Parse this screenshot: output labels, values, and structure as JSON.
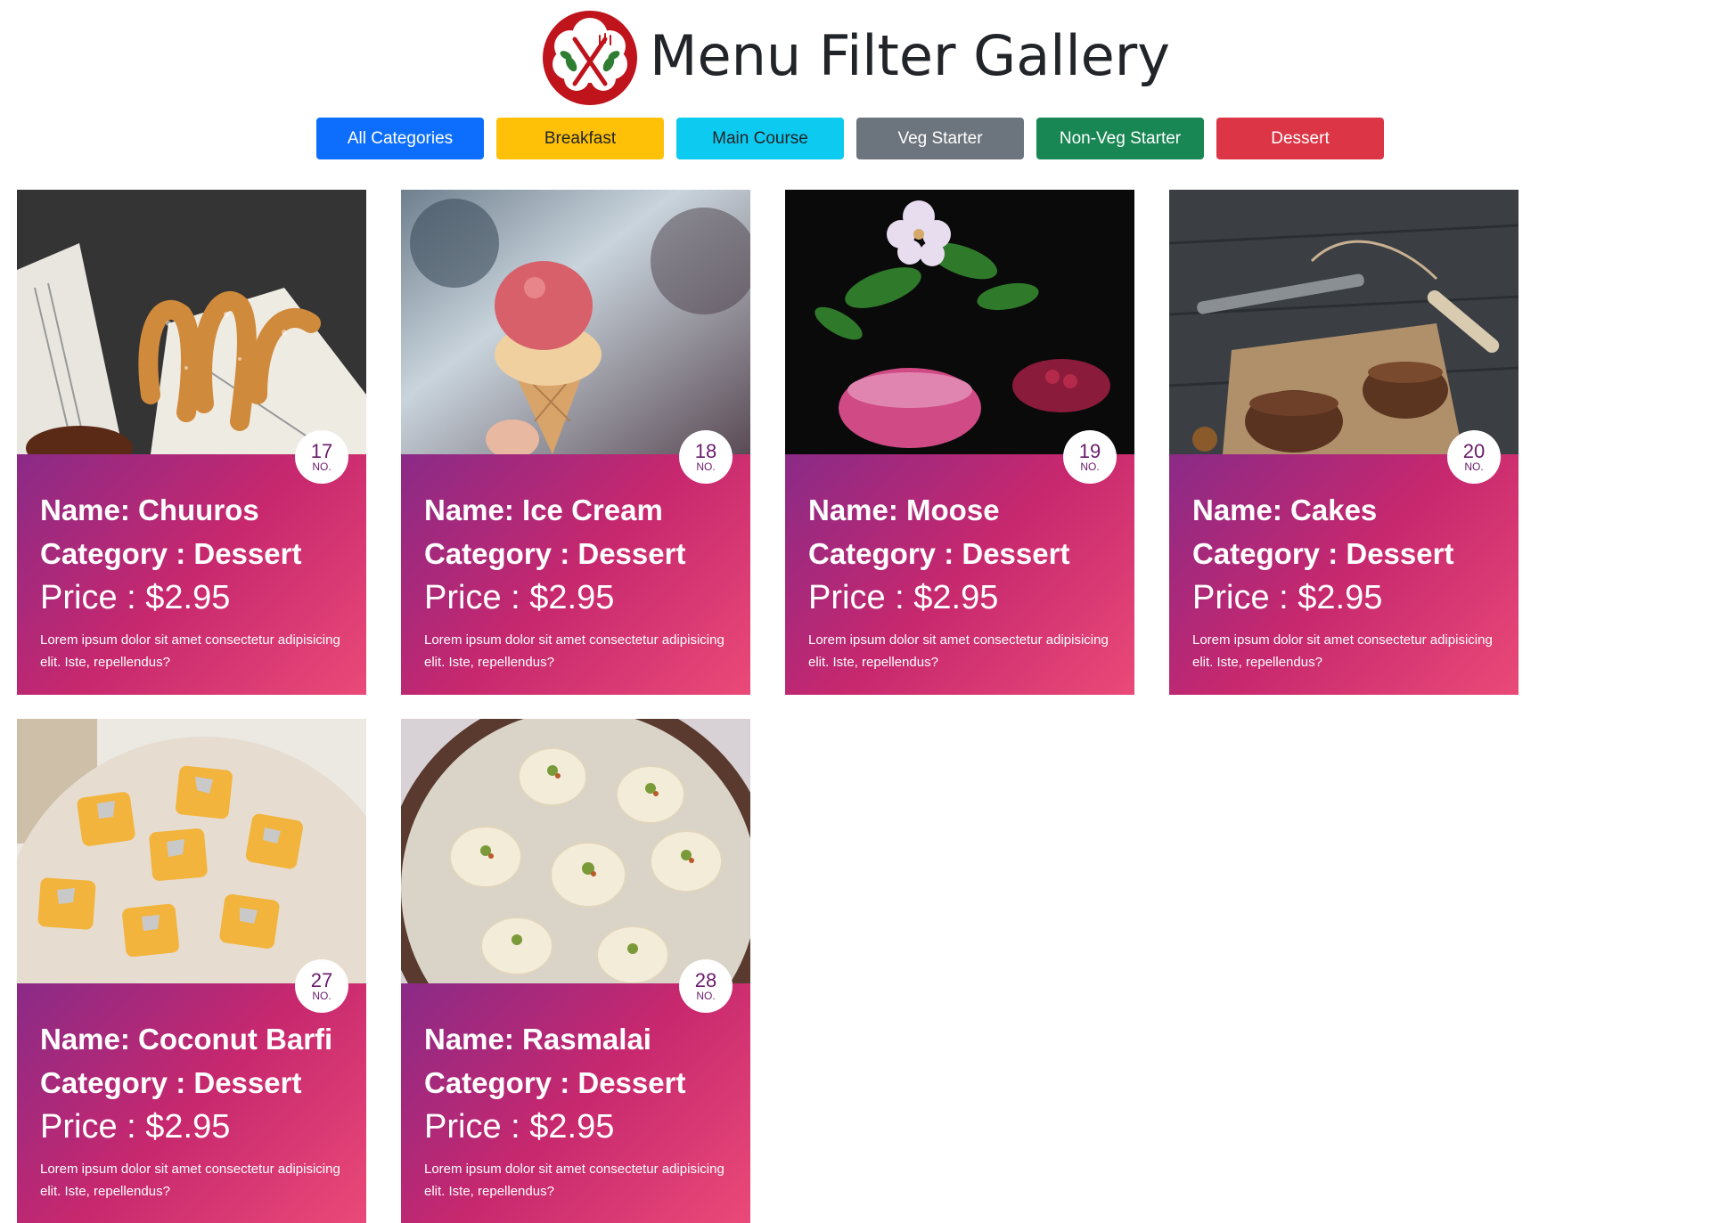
{
  "header": {
    "title": "Menu Filter Gallery",
    "logo_icon": "restaurant-logo-fork-knife-icon"
  },
  "filters": [
    {
      "label": "All Categories",
      "color": "#0d6efd"
    },
    {
      "label": "Breakfast",
      "color": "#ffc107"
    },
    {
      "label": "Main Course",
      "color": "#0dcaf0"
    },
    {
      "label": "Veg Starter",
      "color": "#6c757d"
    },
    {
      "label": "Non-Veg Starter",
      "color": "#198754"
    },
    {
      "label": "Dessert",
      "color": "#dc3545"
    }
  ],
  "cards": [
    {
      "number": "17",
      "no_label": "NO.",
      "name": "Name: Chuuros",
      "category": "Category : Dessert",
      "price": "Price : $2.95",
      "description": "Lorem ipsum dolor sit amet consectetur adipisicing elit. Iste, repellendus?"
    },
    {
      "number": "18",
      "no_label": "NO.",
      "name": "Name: Ice Cream",
      "category": "Category : Dessert",
      "price": "Price : $2.95",
      "description": "Lorem ipsum dolor sit amet consectetur adipisicing elit. Iste, repellendus?"
    },
    {
      "number": "19",
      "no_label": "NO.",
      "name": "Name: Moose",
      "category": "Category : Dessert",
      "price": "Price : $2.95",
      "description": "Lorem ipsum dolor sit amet consectetur adipisicing elit. Iste, repellendus?"
    },
    {
      "number": "20",
      "no_label": "NO.",
      "name": "Name: Cakes",
      "category": "Category : Dessert",
      "price": "Price : $2.95",
      "description": "Lorem ipsum dolor sit amet consectetur adipisicing elit. Iste, repellendus?"
    },
    {
      "number": "27",
      "no_label": "NO.",
      "name": "Name: Coconut Barfi",
      "category": "Category : Dessert",
      "price": "Price : $2.95",
      "description": "Lorem ipsum dolor sit amet consectetur adipisicing elit. Iste, repellendus?"
    },
    {
      "number": "28",
      "no_label": "NO.",
      "name": "Name: Rasmalai",
      "category": "Category : Dessert",
      "price": "Price : $2.95",
      "description": "Lorem ipsum dolor sit amet consectetur adipisicing elit. Iste, repellendus?"
    }
  ],
  "colors": {
    "card_gradient_start": "#8a2a87",
    "card_gradient_end": "#ea4a78",
    "badge_text": "#6a1b6b",
    "logo_red": "#c0141c"
  }
}
